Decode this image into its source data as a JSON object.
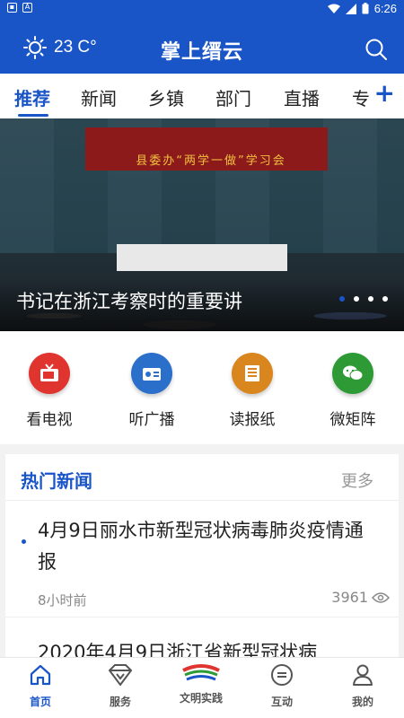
{
  "status_bar": {
    "time": "6:26"
  },
  "header": {
    "temperature": "23 C°",
    "title": "掌上缙云",
    "weather_icon": "sun-icon",
    "search_icon": "search-icon"
  },
  "tabs": [
    "推荐",
    "新闻",
    "乡镇",
    "部门",
    "直播",
    "专"
  ],
  "active_tab": "推荐",
  "banner": {
    "sign_text": "县委办“两学一做”学习会",
    "caption": "书记在浙江考察时的重要讲",
    "slide_count": 4,
    "active_slide": 0
  },
  "quick_links": [
    {
      "label": "看电视",
      "icon": "tv-icon",
      "color": "#e0342e"
    },
    {
      "label": "听广播",
      "icon": "radio-icon",
      "color": "#2a6fc9"
    },
    {
      "label": "读报纸",
      "icon": "newspaper-icon",
      "color": "#d9861e"
    },
    {
      "label": "微矩阵",
      "icon": "wechat-icon",
      "color": "#2e9a35"
    }
  ],
  "hot_news": {
    "title": "热门新闻",
    "more": "更多",
    "items": [
      {
        "headline": "4月9日丽水市新型冠状病毒肺炎疫情通报",
        "time": "8小时前",
        "views": "3961"
      },
      {
        "headline": "2020年4月9日浙江省新型冠状病"
      }
    ]
  },
  "bottom_nav": [
    {
      "label": "首页",
      "icon": "home-icon"
    },
    {
      "label": "服务",
      "icon": "service-icon"
    },
    {
      "label": "文明实践",
      "icon": "civilization-practice-icon"
    },
    {
      "label": "互动",
      "icon": "chat-icon"
    },
    {
      "label": "我的",
      "icon": "profile-icon"
    }
  ],
  "colors": {
    "primary": "#1a55c8"
  }
}
